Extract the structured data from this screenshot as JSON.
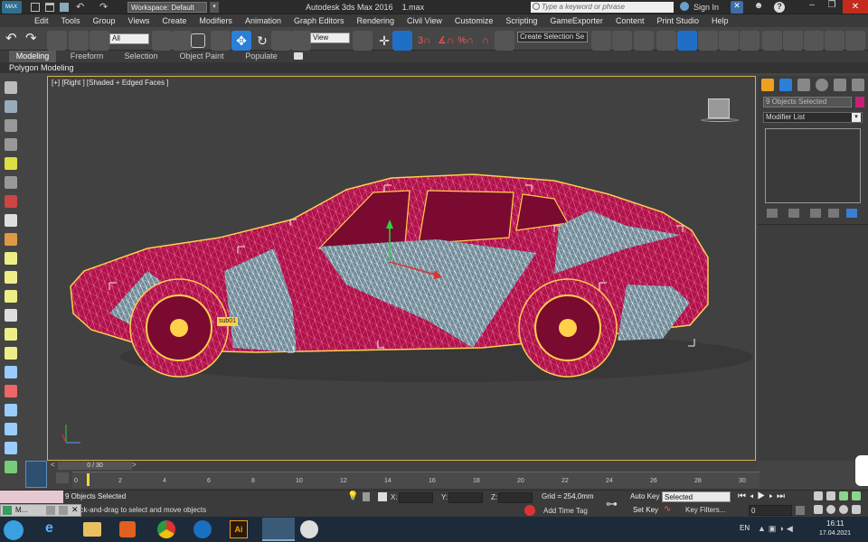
{
  "app": {
    "title": "Autodesk 3ds Max 2016",
    "file": "1.max",
    "workspace": "Workspace: Default",
    "search_placeholder": "Type a keyword or phrase",
    "sign_in": "Sign In"
  },
  "menu": [
    "Edit",
    "Tools",
    "Group",
    "Views",
    "Create",
    "Modifiers",
    "Animation",
    "Graph Editors",
    "Rendering",
    "Civil View",
    "Customize",
    "Scripting",
    "GameExporter",
    "Content",
    "Print Studio",
    "Help"
  ],
  "toolbar": {
    "filter": "All",
    "ref_coord": "View",
    "selection_set": "Create Selection Se"
  },
  "ribbon": {
    "tabs": [
      "Modeling",
      "Freeform",
      "Selection",
      "Object Paint",
      "Populate"
    ],
    "active_tab": "Modeling",
    "sub_label": "Polygon Modeling"
  },
  "viewport": {
    "label": "[+] [Right ] [Shaded + Edged Faces ]",
    "tag": "sub01"
  },
  "command_panel": {
    "selection_name": "9 Objects Selected",
    "modifier_list": "Modifier List"
  },
  "timeline": {
    "frame_label": "0 / 30",
    "ticks": [
      "0",
      "2",
      "4",
      "6",
      "8",
      "10",
      "12",
      "14",
      "16",
      "18",
      "20",
      "22",
      "24",
      "26",
      "28",
      "30"
    ]
  },
  "status": {
    "selected": "9 Objects Selected",
    "prompt": "Click or click-and-drag to select and move objects",
    "grid": "Grid = 254,0mm",
    "add_time_tag": "Add Time Tag",
    "auto_key": "Auto Key",
    "set_key": "Set Key",
    "key_mode": "Selected",
    "key_filters": "Key Filters...",
    "frame": "0",
    "x_label": "X:",
    "y_label": "Y:",
    "z_label": "Z:"
  },
  "taskbar": {
    "app_item": "M...",
    "lang": "EN",
    "time": "16:11",
    "date": "17.04.2021"
  },
  "colors": {
    "accent": "#d8b24a",
    "car": "#b0124a",
    "wire_white": "#ffffff",
    "wire_cyan": "#c8f2ff",
    "select_blue": "#2a7fd8"
  }
}
